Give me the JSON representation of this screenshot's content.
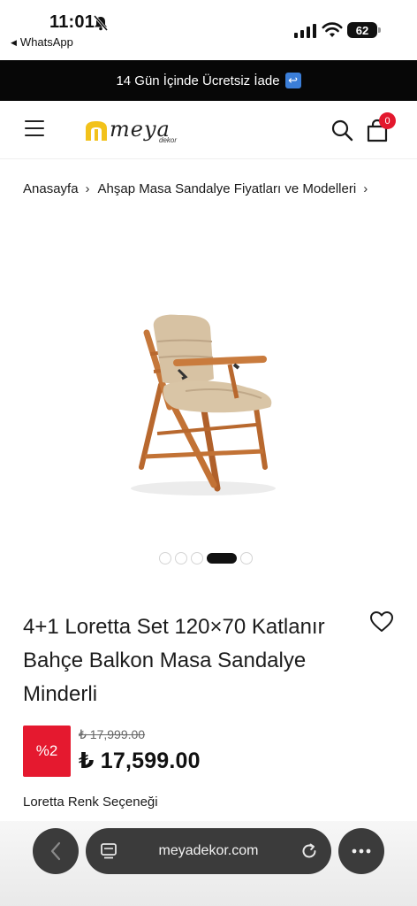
{
  "status_bar": {
    "time": "11:01",
    "back_app": "WhatsApp",
    "battery": "62"
  },
  "promo": {
    "text": "14 Gün İçinde Ücretsiz İade",
    "icon": "return-arrow-icon"
  },
  "header": {
    "logo_text": "meya",
    "logo_sub": "dekor",
    "cart_count": "0"
  },
  "breadcrumb": {
    "items": [
      "Anasayfa",
      "Ahşap Masa Sandalye Fiyatları ve Modelleri"
    ]
  },
  "gallery": {
    "total_slides": 5,
    "active_index": 3
  },
  "product": {
    "title": "4+1 Loretta Set 120×70 Katlanır Bahçe Balkon Masa Sandalye Minderli",
    "discount_badge": "%2",
    "old_price": "₺ 17,999.00",
    "new_price": "₺ 17,599.00",
    "color_option_label": "Loretta Renk Seçeneği"
  },
  "browser": {
    "url": "meyadekor.com"
  },
  "colors": {
    "promo_bg": "#070707",
    "badge_red": "#e5192f",
    "toolbar_bg": "#3b3b3b"
  }
}
